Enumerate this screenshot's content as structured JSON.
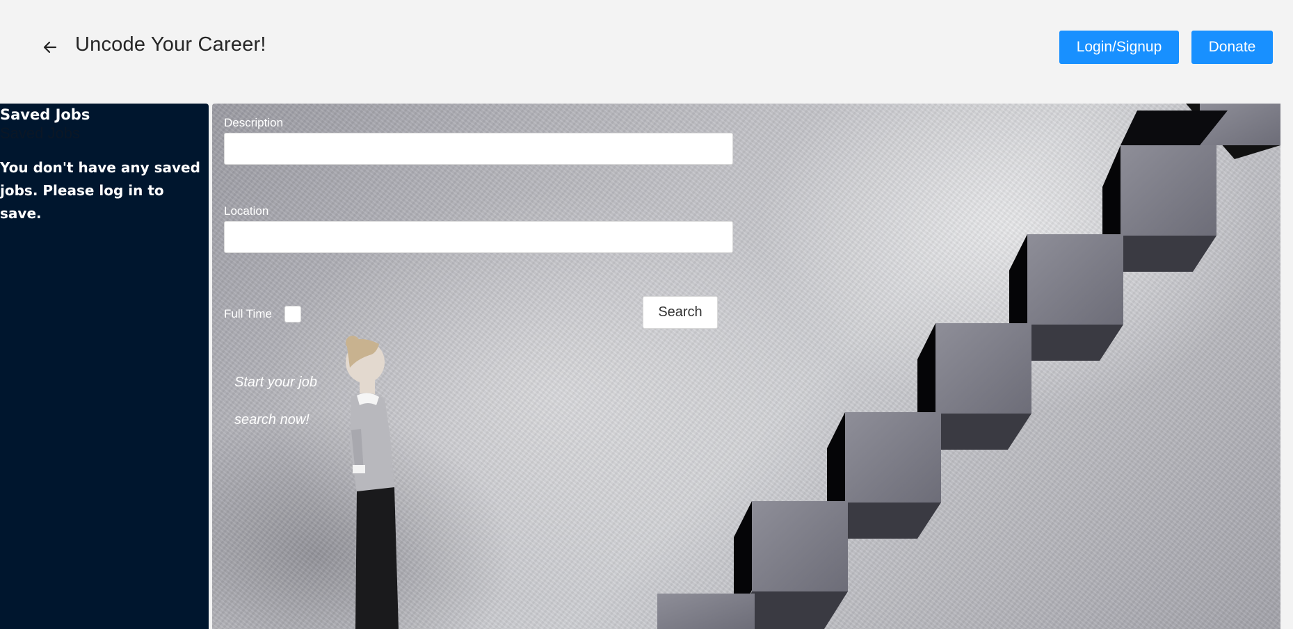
{
  "header": {
    "title": "Uncode Your Career!",
    "back_icon": "arrow-left-icon",
    "login_label": "Login/Signup",
    "donate_label": "Donate"
  },
  "sidebar": {
    "heading": "Saved Jobs",
    "subheading": "Saved Jobs",
    "message": "You don't have any saved jobs. Please log in to save."
  },
  "search": {
    "description_label": "Description",
    "description_value": "",
    "location_label": "Location",
    "location_value": "",
    "fulltime_label": "Full Time",
    "fulltime_checked": false,
    "search_label": "Search"
  },
  "hero": {
    "tagline": "Start your job search now!"
  },
  "colors": {
    "header_bg": "#f3f3f3",
    "accent": "#1890ff",
    "sidebar_bg": "#00162e"
  }
}
